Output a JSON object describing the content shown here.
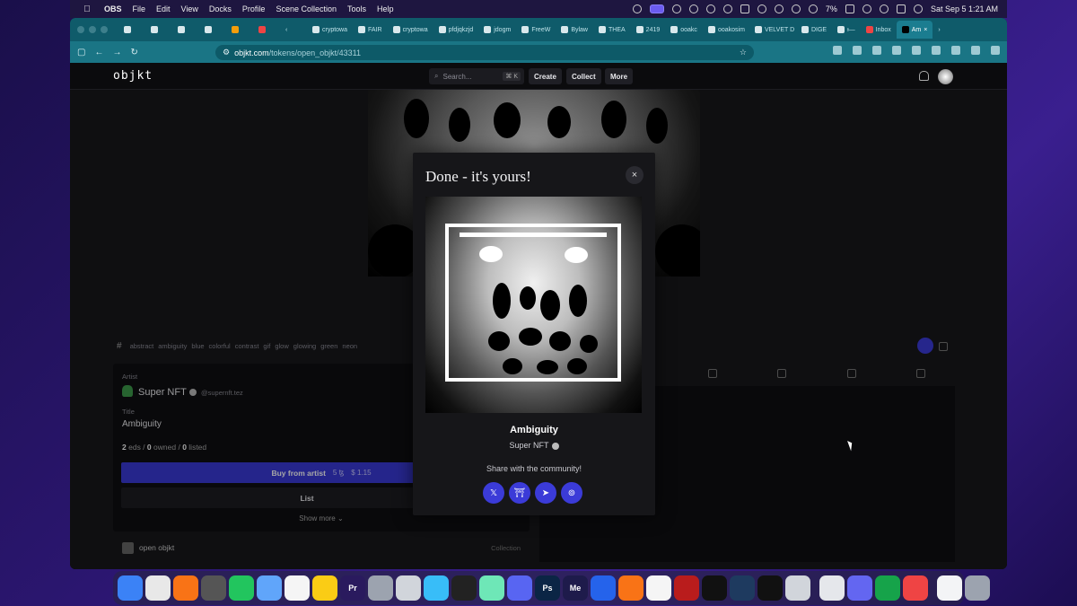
{
  "menubar": {
    "app": "OBS",
    "items": [
      "File",
      "Edit",
      "View",
      "Docks",
      "Profile",
      "Scene Collection",
      "Tools",
      "Help"
    ],
    "battery": "7%",
    "clock": "Sat Sep 5  1:21 AM"
  },
  "browser": {
    "tabs": [
      "cryptowa",
      "FAIR",
      "cryptowa",
      "pfdjqkzjd",
      "jdogm",
      "FreeW",
      "Bylaw",
      "THEA",
      "2419",
      "ooakc",
      "ooakosim",
      "VELVET D",
      "DIGE",
      "ᵻ—",
      "Inbox",
      "Am"
    ],
    "url_host": "objkt.com",
    "url_path": "/tokens/open_objkt/43311"
  },
  "site": {
    "logo": "objkt",
    "search_placeholder": "Search...",
    "search_kbd": "⌘ K",
    "nav": {
      "create": "Create",
      "collect": "Collect",
      "more": "More"
    }
  },
  "tags": [
    "abstract",
    "ambiguity",
    "blue",
    "colorful",
    "contrast",
    "gif",
    "glow",
    "glowing",
    "green",
    "neon"
  ],
  "token": {
    "artist_label": "Artist",
    "artist_name": "Super NFT",
    "artist_handle": "@supernft.tez",
    "title_label": "Title",
    "title": "Ambiguity",
    "eds": "2",
    "eds_label": "eds /",
    "owned": "0",
    "owned_label": "owned /",
    "listed": "0",
    "listed_label": "listed",
    "buy_label": "Buy from artist",
    "price_tez": "5 ꜩ",
    "price_usd": "$ 1.15",
    "list_label": "List",
    "more_dots": "···",
    "show_more": "Show more",
    "collection_name": "open objkt",
    "collection_label": "Collection"
  },
  "modal": {
    "title": "Done - it's yours!",
    "close": "×",
    "token_title": "Ambiguity",
    "token_artist": "Super NFT",
    "share_text": "Share with the community!",
    "share_buttons": [
      "𝕏",
      "⛩",
      "➤",
      "⊚"
    ]
  },
  "dock": {
    "icons": [
      {
        "name": "finder-icon",
        "color": "#3b82f6"
      },
      {
        "name": "chrome-icon",
        "color": "#e8e8e8"
      },
      {
        "name": "firefox-icon",
        "color": "#f97316"
      },
      {
        "name": "launchpad-icon",
        "color": "#555"
      },
      {
        "name": "messages-icon",
        "color": "#22c55e"
      },
      {
        "name": "preview-icon",
        "color": "#60a5fa"
      },
      {
        "name": "reminders-icon",
        "color": "#f5f5f5"
      },
      {
        "name": "notes-icon",
        "color": "#facc15"
      },
      {
        "name": "premiere-icon",
        "color": "#2a1a5e",
        "label": "Pr"
      },
      {
        "name": "settings-icon",
        "color": "#9ca3af"
      },
      {
        "name": "safari-icon",
        "color": "#d1d5db"
      },
      {
        "name": "telegram-icon",
        "color": "#38bdf8"
      },
      {
        "name": "obs-icon",
        "color": "#222"
      },
      {
        "name": "brush-icon",
        "color": "#6ee7b7"
      },
      {
        "name": "discord-icon",
        "color": "#5865f2"
      },
      {
        "name": "photoshop-icon",
        "color": "#0b2545",
        "label": "Ps"
      },
      {
        "name": "media-encoder-icon",
        "color": "#1e1b4b",
        "label": "Me"
      },
      {
        "name": "vscode-icon",
        "color": "#2563eb"
      },
      {
        "name": "sparkle-icon",
        "color": "#f97316"
      },
      {
        "name": "chatgpt-icon",
        "color": "#f5f5f5"
      },
      {
        "name": "filezilla-icon",
        "color": "#b91c1c"
      },
      {
        "name": "terminal-icon",
        "color": "#111"
      },
      {
        "name": "steam-icon",
        "color": "#1e3a5f"
      },
      {
        "name": "activity-monitor-icon",
        "color": "#111"
      },
      {
        "name": "backup-icon",
        "color": "#d1d5db"
      },
      {
        "name": "installer-icon",
        "color": "#e5e7eb"
      },
      {
        "name": "lists-icon",
        "color": "#6366f1"
      },
      {
        "name": "spotify-icon",
        "color": "#16a34a"
      },
      {
        "name": "creative-cloud-icon",
        "color": "#ef4444"
      },
      {
        "name": "document-icon",
        "color": "#f3f4f6"
      },
      {
        "name": "trash-icon",
        "color": "#9ca3af"
      }
    ]
  },
  "colors": {
    "accent": "#3b3bd8",
    "browser_chrome": "#1a7585",
    "page_bg": "#17171b"
  }
}
